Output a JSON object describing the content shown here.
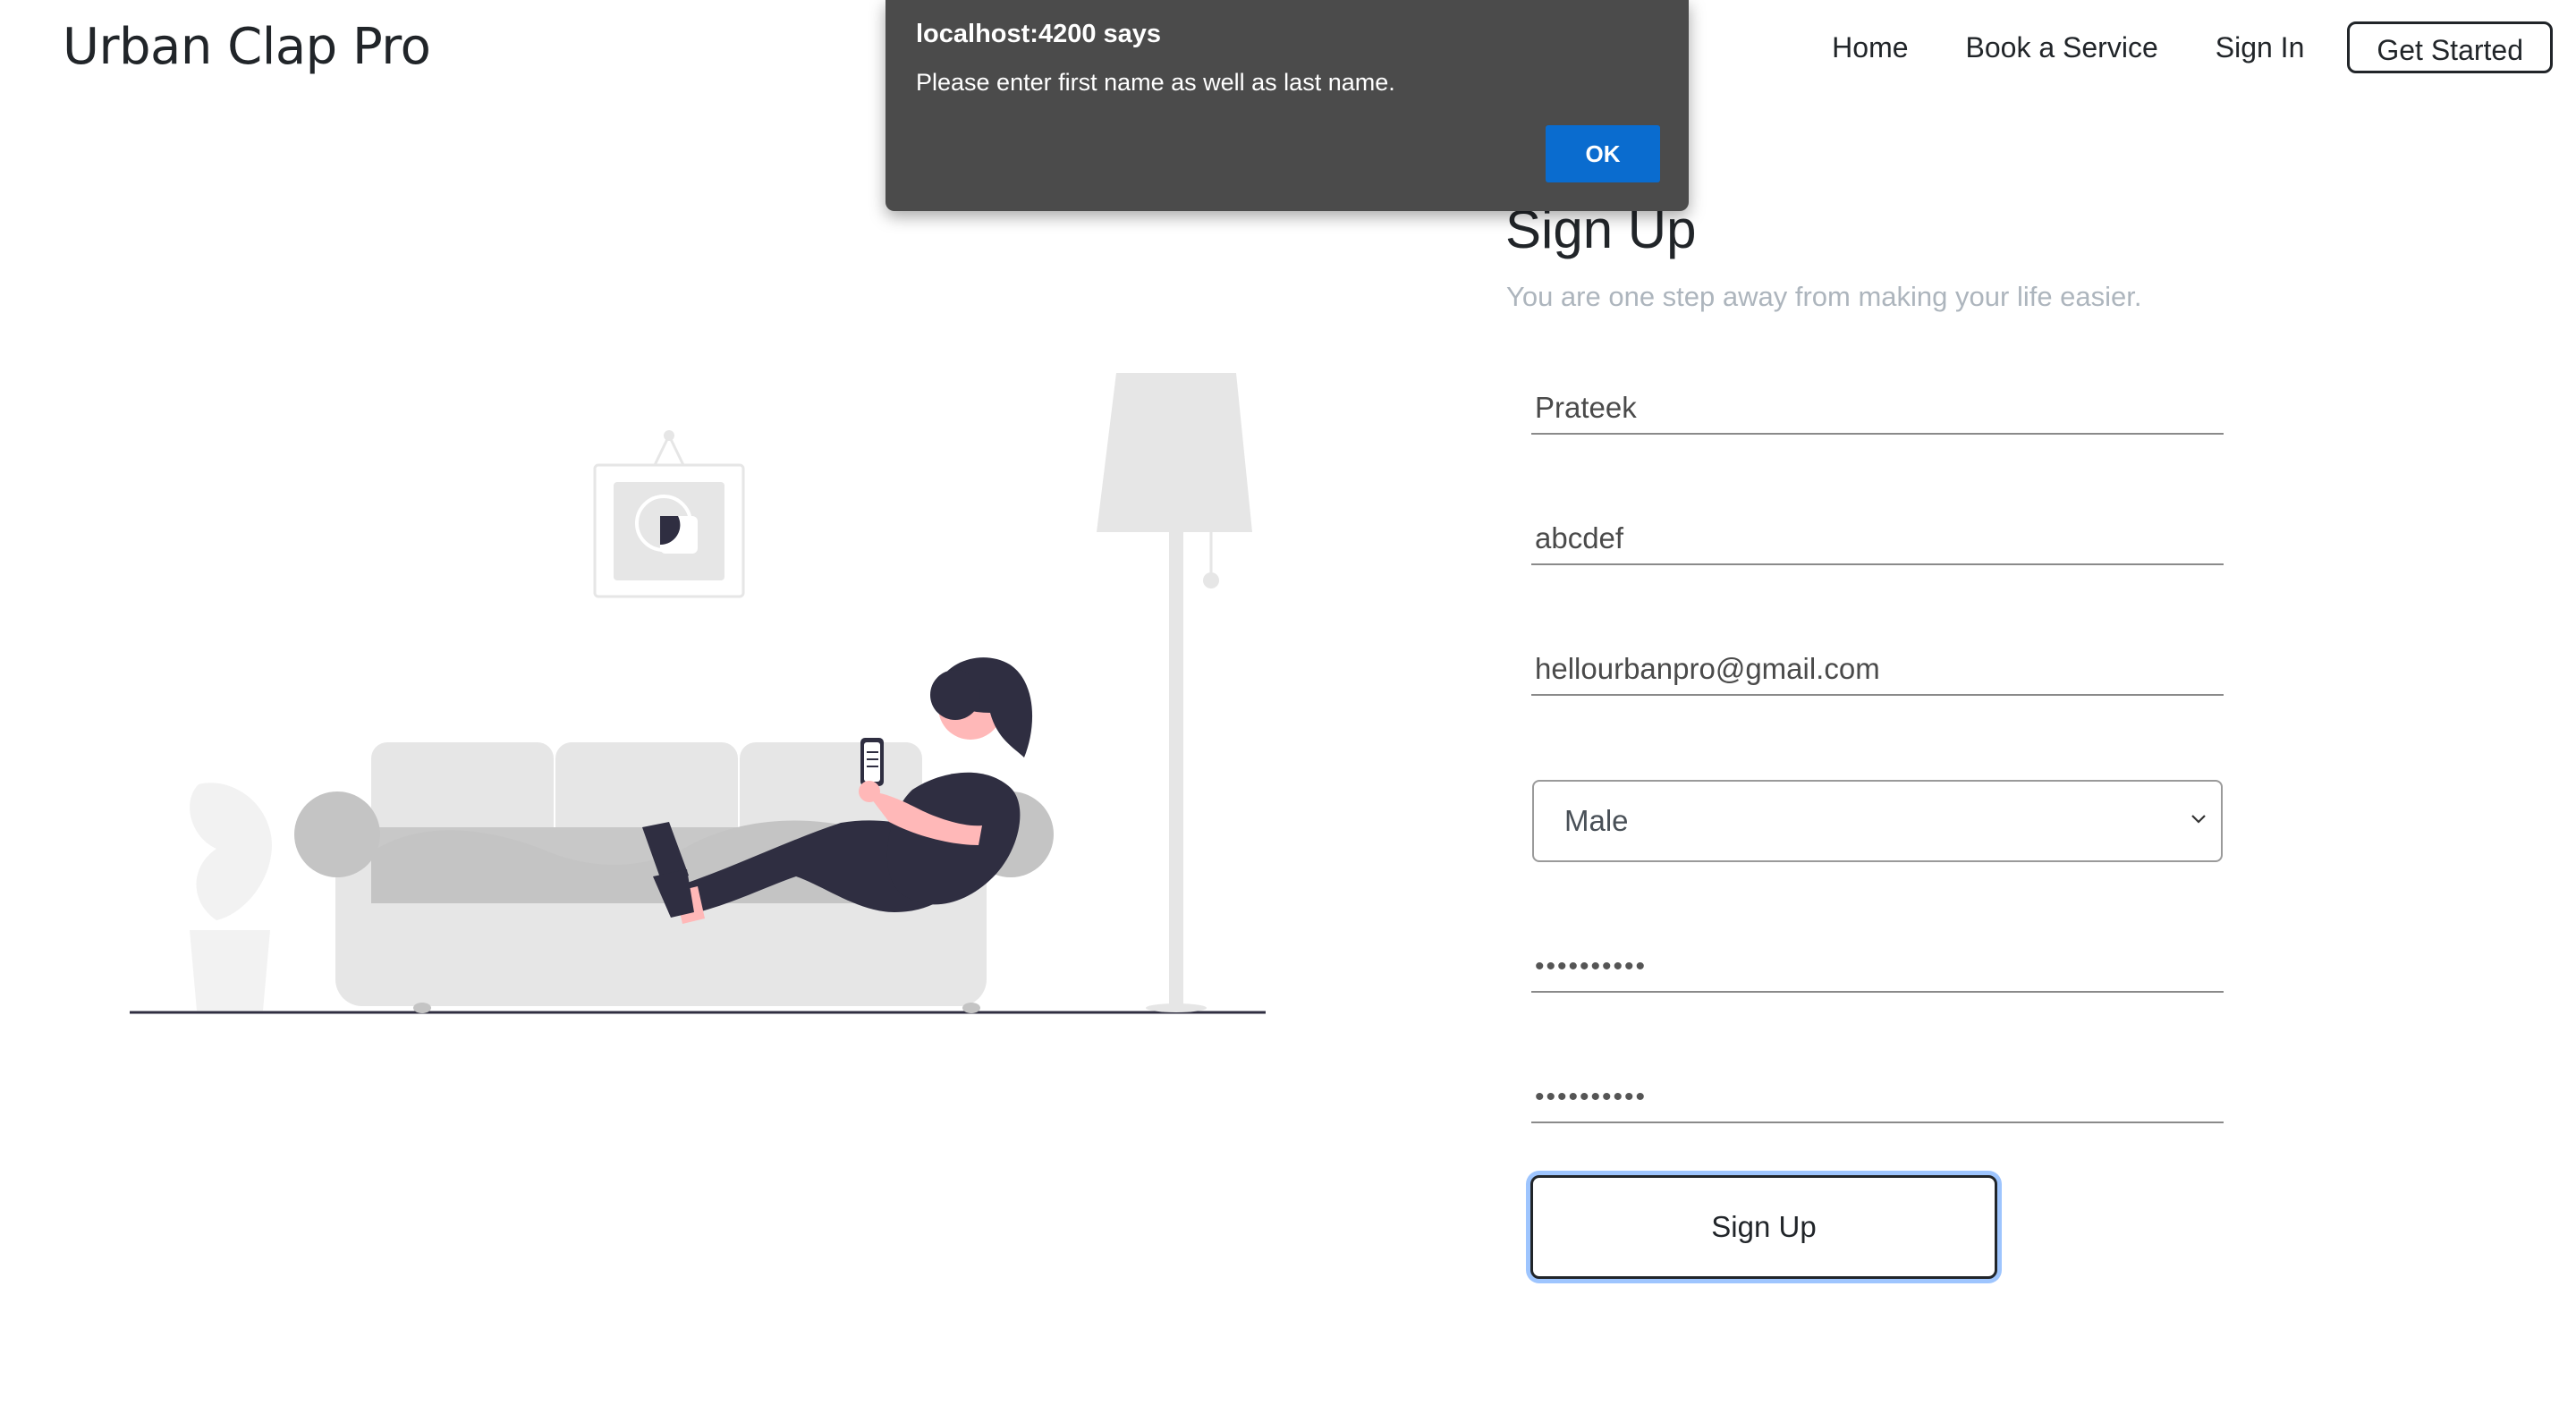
{
  "navbar": {
    "brand": "Urban Clap Pro",
    "links": {
      "home": "Home",
      "book_service": "Book a Service",
      "sign_in": "Sign In"
    },
    "get_started": "Get Started"
  },
  "signup": {
    "title": "Sign Up",
    "subtitle": "You are one step away from making your life easier.",
    "first_name_value": "Prateek",
    "last_name_value": "abcdef",
    "email_value": "hellourbanpro@gmail.com",
    "gender_selected": "Male",
    "gender_options": [
      "Male"
    ],
    "password_value": "••••••••••",
    "confirm_password_value": "••••••••••",
    "submit_label": "Sign Up"
  },
  "alert": {
    "title": "localhost:4200 says",
    "message": "Please enter first name as well as last name.",
    "ok_label": "OK"
  },
  "colors": {
    "alert_bg": "#4b4b4b",
    "ok_button": "#0a6ccf",
    "focus_ring": "#9ec5fe",
    "illustration_gray": "#e6e6e6",
    "person_dark": "#2f2e41",
    "skin": "#ffb8b8"
  },
  "icons": {
    "select_arrow": "chevron-down-icon"
  }
}
